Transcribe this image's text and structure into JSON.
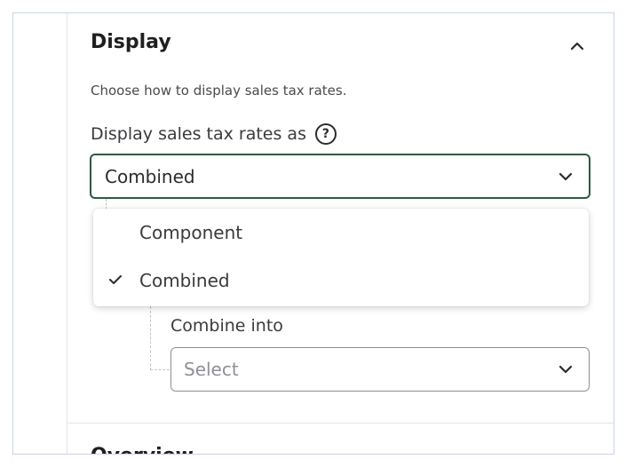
{
  "display_section": {
    "title": "Display",
    "description": "Choose how to display sales tax rates.",
    "field_label": "Display sales tax rates as",
    "help_symbol": "?",
    "selected_value": "Combined",
    "options": [
      {
        "label": "Component",
        "checked": false
      },
      {
        "label": "Combined",
        "checked": true
      }
    ],
    "combine_into": {
      "label": "Combine into",
      "placeholder": "Select"
    }
  },
  "next_section": {
    "title_partial": "Overview"
  },
  "colors": {
    "focus_border": "#2a5c3f",
    "frame_border": "#c9d3ec",
    "divider": "#e3e5e8",
    "placeholder": "#8d9096"
  },
  "icons": [
    "chevron-up-icon",
    "help-circle-icon",
    "chevron-down-icon",
    "check-icon"
  ]
}
